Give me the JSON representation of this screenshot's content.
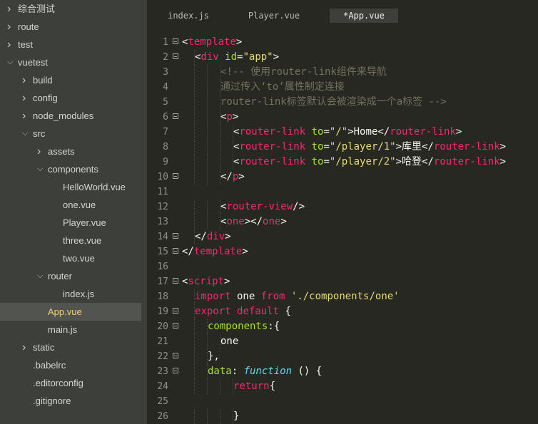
{
  "file_tree": [
    {
      "label": "综合测试",
      "arrow": ">",
      "depth": 0,
      "selected": false
    },
    {
      "label": "route",
      "arrow": ">",
      "depth": 0,
      "selected": false
    },
    {
      "label": "test",
      "arrow": ">",
      "depth": 0,
      "selected": false
    },
    {
      "label": "vuetest",
      "arrow": "v",
      "depth": 0,
      "selected": false
    },
    {
      "label": "build",
      "arrow": ">",
      "depth": 1,
      "selected": false
    },
    {
      "label": "config",
      "arrow": ">",
      "depth": 1,
      "selected": false
    },
    {
      "label": "node_modules",
      "arrow": ">",
      "depth": 1,
      "selected": false
    },
    {
      "label": "src",
      "arrow": "v",
      "depth": 1,
      "selected": false
    },
    {
      "label": "assets",
      "arrow": ">",
      "depth": 2,
      "selected": false
    },
    {
      "label": "components",
      "arrow": "v",
      "depth": 2,
      "selected": false
    },
    {
      "label": "HelloWorld.vue",
      "arrow": "",
      "depth": 3,
      "selected": false
    },
    {
      "label": "one.vue",
      "arrow": "",
      "depth": 3,
      "selected": false
    },
    {
      "label": "Player.vue",
      "arrow": "",
      "depth": 3,
      "selected": false
    },
    {
      "label": "three.vue",
      "arrow": "",
      "depth": 3,
      "selected": false
    },
    {
      "label": "two.vue",
      "arrow": "",
      "depth": 3,
      "selected": false
    },
    {
      "label": "router",
      "arrow": "v",
      "depth": 2,
      "selected": false
    },
    {
      "label": "index.js",
      "arrow": "",
      "depth": 3,
      "selected": false
    },
    {
      "label": "App.vue",
      "arrow": "",
      "depth": 2,
      "selected": true
    },
    {
      "label": "main.js",
      "arrow": "",
      "depth": 2,
      "selected": false
    },
    {
      "label": "static",
      "arrow": ">",
      "depth": 1,
      "selected": false
    },
    {
      "label": ".babelrc",
      "arrow": "",
      "depth": 1,
      "selected": false
    },
    {
      "label": ".editorconfig",
      "arrow": "",
      "depth": 1,
      "selected": false
    },
    {
      "label": ".gitignore",
      "arrow": "",
      "depth": 1,
      "selected": false
    }
  ],
  "tabs": [
    {
      "label": "index.js",
      "active": false
    },
    {
      "label": "Player.vue",
      "active": false
    },
    {
      "label": "*App.vue",
      "active": true
    }
  ],
  "code_lines": [
    {
      "num": "1",
      "fold": true,
      "indent": 0,
      "tokens": [
        [
          "t-punc",
          "<"
        ],
        [
          "t-tag",
          "template"
        ],
        [
          "t-punc",
          ">"
        ]
      ]
    },
    {
      "num": "2",
      "fold": true,
      "indent": 1,
      "tokens": [
        [
          "t-punc",
          "<"
        ],
        [
          "t-tag",
          "div"
        ],
        [
          "t-punc",
          " "
        ],
        [
          "t-attr",
          "id"
        ],
        [
          "t-punc",
          "="
        ],
        [
          "t-str",
          "\"app\""
        ],
        [
          "t-punc",
          ">"
        ]
      ]
    },
    {
      "num": "3",
      "fold": false,
      "indent": 3,
      "tokens": [
        [
          "t-com",
          "<!-- 使用router-link组件来导航"
        ]
      ]
    },
    {
      "num": "4",
      "fold": false,
      "indent": 3,
      "tokens": [
        [
          "t-com",
          "通过传入‘to’属性制定连接"
        ]
      ]
    },
    {
      "num": "5",
      "fold": false,
      "indent": 3,
      "tokens": [
        [
          "t-com",
          "router-link标签默认会被渲染成一个a标签 -->"
        ]
      ]
    },
    {
      "num": "6",
      "fold": true,
      "indent": 3,
      "tokens": [
        [
          "t-punc",
          "<"
        ],
        [
          "t-tag",
          "p"
        ],
        [
          "t-punc",
          ">"
        ]
      ]
    },
    {
      "num": "7",
      "fold": false,
      "indent": 4,
      "tokens": [
        [
          "t-punc",
          "<"
        ],
        [
          "t-tag",
          "router-link"
        ],
        [
          "t-punc",
          " "
        ],
        [
          "t-attr",
          "to"
        ],
        [
          "t-punc",
          "="
        ],
        [
          "t-str",
          "\"/\""
        ],
        [
          "t-punc",
          ">"
        ],
        [
          "t-text",
          "Home"
        ],
        [
          "t-punc",
          "</"
        ],
        [
          "t-tag",
          "router-link"
        ],
        [
          "t-punc",
          ">"
        ]
      ]
    },
    {
      "num": "8",
      "fold": false,
      "indent": 4,
      "tokens": [
        [
          "t-punc",
          "<"
        ],
        [
          "t-tag",
          "router-link"
        ],
        [
          "t-punc",
          " "
        ],
        [
          "t-attr",
          "to"
        ],
        [
          "t-punc",
          "="
        ],
        [
          "t-str",
          "\"/player/1\""
        ],
        [
          "t-punc",
          ">"
        ],
        [
          "t-text",
          "库里"
        ],
        [
          "t-punc",
          "</"
        ],
        [
          "t-tag",
          "router-link"
        ],
        [
          "t-punc",
          ">"
        ]
      ]
    },
    {
      "num": "9",
      "fold": false,
      "indent": 4,
      "tokens": [
        [
          "t-punc",
          "<"
        ],
        [
          "t-tag",
          "router-link"
        ],
        [
          "t-punc",
          " "
        ],
        [
          "t-attr",
          "to"
        ],
        [
          "t-punc",
          "="
        ],
        [
          "t-str",
          "\"/player/2\""
        ],
        [
          "t-punc",
          ">"
        ],
        [
          "t-text",
          "哈登"
        ],
        [
          "t-punc",
          "</"
        ],
        [
          "t-tag",
          "router-link"
        ],
        [
          "t-punc",
          ">"
        ]
      ]
    },
    {
      "num": "10",
      "fold": true,
      "indent": 3,
      "tokens": [
        [
          "t-punc",
          "</"
        ],
        [
          "t-tag",
          "p"
        ],
        [
          "t-punc",
          ">"
        ]
      ]
    },
    {
      "num": "11",
      "fold": false,
      "indent": 0,
      "tokens": []
    },
    {
      "num": "12",
      "fold": false,
      "indent": 3,
      "tokens": [
        [
          "t-punc",
          "<"
        ],
        [
          "t-tag",
          "router-view"
        ],
        [
          "t-punc",
          "/>"
        ]
      ]
    },
    {
      "num": "13",
      "fold": false,
      "indent": 3,
      "tokens": [
        [
          "t-punc",
          "<"
        ],
        [
          "t-tag",
          "one"
        ],
        [
          "t-punc",
          "></"
        ],
        [
          "t-tag",
          "one"
        ],
        [
          "t-punc",
          ">"
        ]
      ]
    },
    {
      "num": "14",
      "fold": true,
      "indent": 1,
      "tokens": [
        [
          "t-punc",
          "</"
        ],
        [
          "t-tag",
          "div"
        ],
        [
          "t-punc",
          ">"
        ]
      ]
    },
    {
      "num": "15",
      "fold": true,
      "indent": 0,
      "tokens": [
        [
          "t-punc",
          "</"
        ],
        [
          "t-tag",
          "template"
        ],
        [
          "t-punc",
          ">"
        ]
      ]
    },
    {
      "num": "16",
      "fold": false,
      "indent": 0,
      "tokens": []
    },
    {
      "num": "17",
      "fold": true,
      "indent": 0,
      "tokens": [
        [
          "t-punc",
          "<"
        ],
        [
          "t-tag",
          "script"
        ],
        [
          "t-punc",
          ">"
        ]
      ]
    },
    {
      "num": "18",
      "fold": false,
      "indent": 1,
      "tokens": [
        [
          "t-kw",
          "import"
        ],
        [
          "t-text",
          " one "
        ],
        [
          "t-kw",
          "from"
        ],
        [
          "t-text",
          " "
        ],
        [
          "t-str",
          "'./components/one'"
        ]
      ]
    },
    {
      "num": "19",
      "fold": true,
      "indent": 1,
      "tokens": [
        [
          "t-kw",
          "export"
        ],
        [
          "t-text",
          " "
        ],
        [
          "t-kw",
          "default"
        ],
        [
          "t-text",
          " {"
        ]
      ]
    },
    {
      "num": "20",
      "fold": true,
      "indent": 2,
      "tokens": [
        [
          "t-key",
          "components"
        ],
        [
          "t-text",
          ":{"
        ]
      ]
    },
    {
      "num": "21",
      "fold": false,
      "indent": 3,
      "tokens": [
        [
          "t-text",
          "one"
        ]
      ]
    },
    {
      "num": "22",
      "fold": true,
      "indent": 2,
      "tokens": [
        [
          "t-text",
          "},"
        ]
      ]
    },
    {
      "num": "23",
      "fold": true,
      "indent": 2,
      "tokens": [
        [
          "t-key",
          "data"
        ],
        [
          "t-text",
          ": "
        ],
        [
          "t-fn",
          "function"
        ],
        [
          "t-text",
          " () {"
        ]
      ]
    },
    {
      "num": "24",
      "fold": false,
      "indent": 4,
      "tokens": [
        [
          "t-kw",
          "return"
        ],
        [
          "t-text",
          "{"
        ]
      ]
    },
    {
      "num": "25",
      "fold": false,
      "indent": 0,
      "tokens": []
    },
    {
      "num": "26",
      "fold": false,
      "indent": 4,
      "tokens": [
        [
          "t-text",
          "}"
        ]
      ]
    }
  ]
}
